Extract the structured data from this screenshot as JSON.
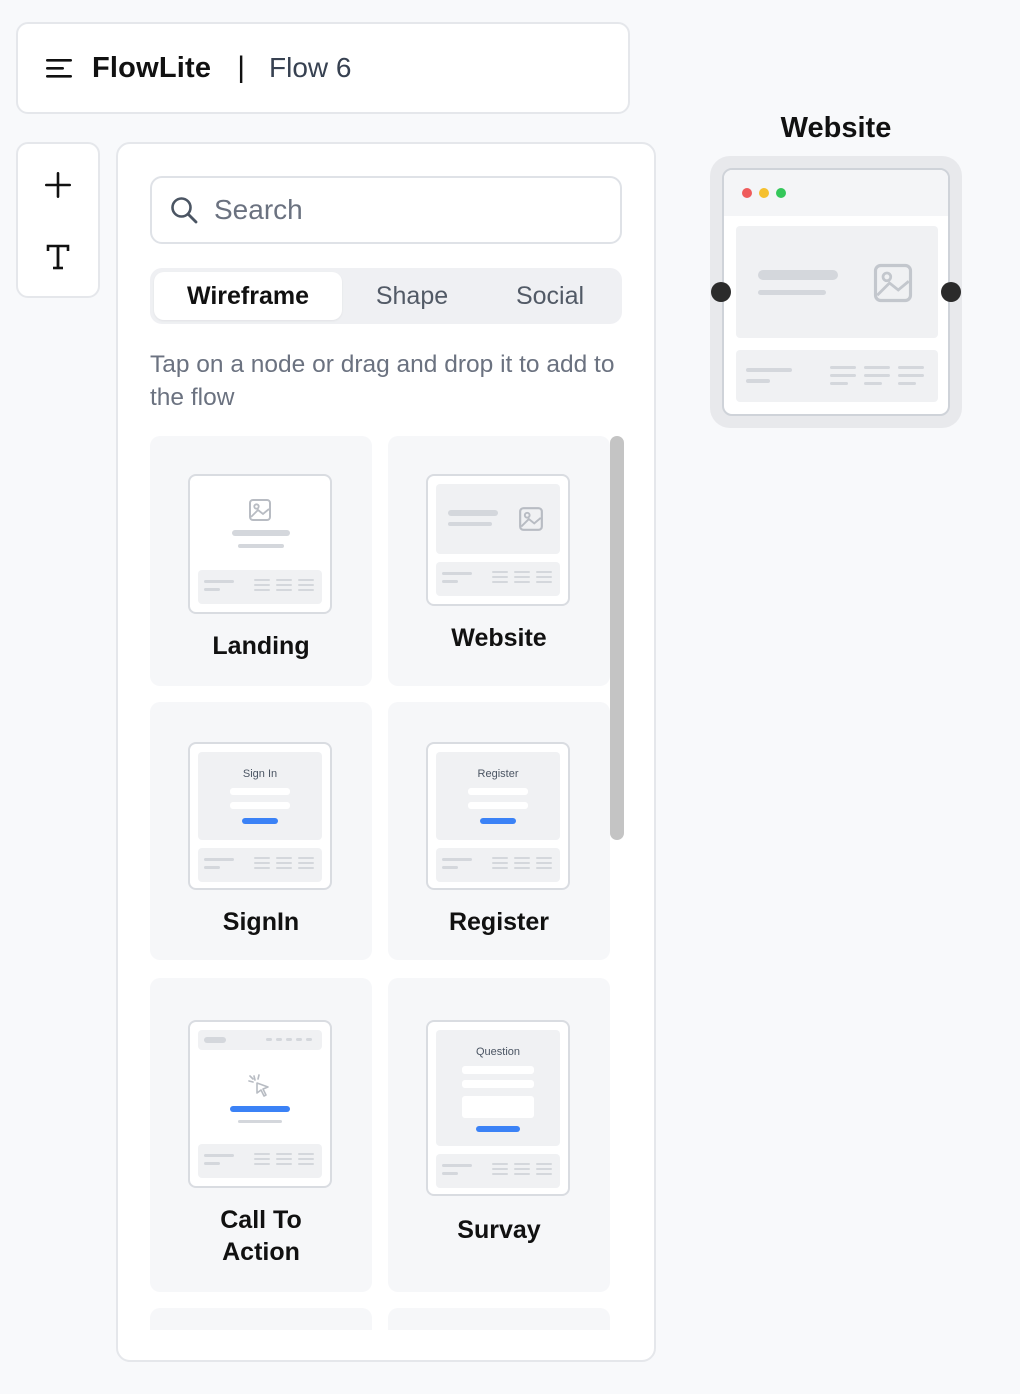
{
  "header": {
    "app_name": "FlowLite",
    "separator": "|",
    "flow_name": "Flow 6"
  },
  "toolbar": {
    "icons": [
      "plus-icon",
      "text-tool-icon"
    ]
  },
  "search": {
    "placeholder": "Search",
    "value": ""
  },
  "tabs": [
    {
      "label": "Wireframe",
      "active": true
    },
    {
      "label": "Shape",
      "active": false
    },
    {
      "label": "Social",
      "active": false
    }
  ],
  "hint": "Tap on a node or drag and drop it to add to the flow",
  "nodes": [
    {
      "label": "Landing",
      "mini_text": ""
    },
    {
      "label": "Website",
      "mini_text": ""
    },
    {
      "label": "SignIn",
      "mini_text": "Sign In"
    },
    {
      "label": "Register",
      "mini_text": "Register"
    },
    {
      "label": "Call To Action",
      "mini_text": ""
    },
    {
      "label": "Survay",
      "mini_text": "Question"
    }
  ],
  "canvas": {
    "node_title": "Website"
  },
  "colors": {
    "accent_blue": "#3b82f6",
    "dot_red": "#ef5b5b",
    "dot_yellow": "#f5c02e",
    "dot_green": "#34c75a",
    "handle": "#2b2b2b"
  }
}
